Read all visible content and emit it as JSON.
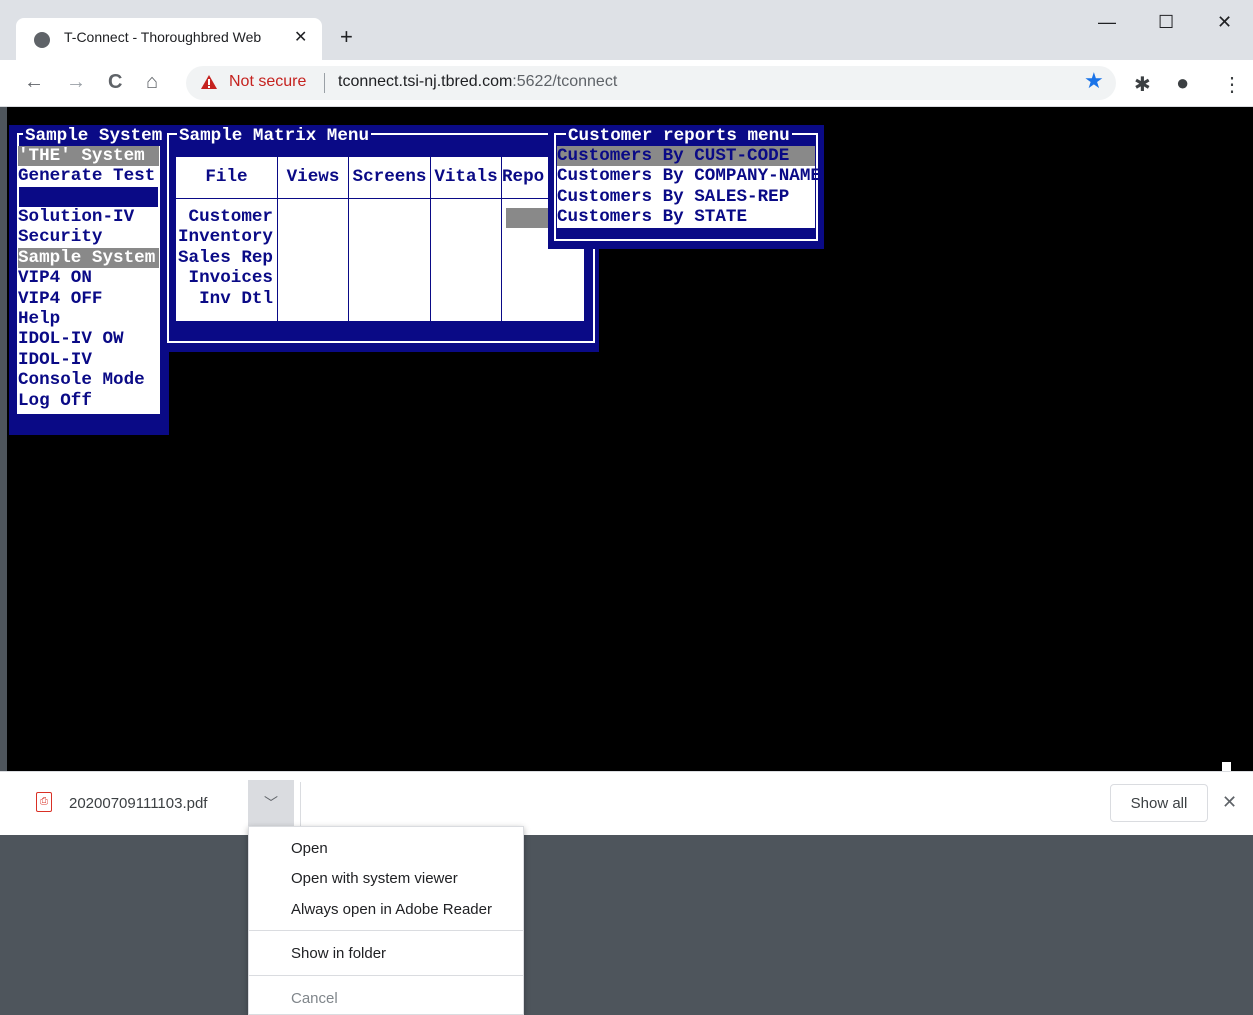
{
  "browser": {
    "tab_title": "T-Connect - Thoroughbred Web",
    "tab_close": "✕",
    "new_tab": "+",
    "win_minimize": "—",
    "win_maximize": "☐",
    "win_close": "✕",
    "back": "←",
    "forward": "→",
    "reload": "C",
    "home": "⌂",
    "not_secure": "Not secure",
    "url_host": "tconnect.tsi-nj.tbred.com",
    "url_rest": ":5622/tconnect",
    "star": "★",
    "extensions": "✱",
    "profile": "●",
    "menu": "⋮"
  },
  "terminal": {
    "system_menu": {
      "title": "Sample System",
      "items_top": [
        "'THE' System",
        "Generate Test"
      ],
      "items": [
        "Solution-IV",
        "Security",
        "Sample System",
        "VIP4 ON",
        "VIP4 OFF",
        "Help",
        "IDOL-IV OW",
        "IDOL-IV",
        "Console Mode",
        "Log Off"
      ]
    },
    "matrix_menu": {
      "title": "Sample Matrix Menu",
      "columns": [
        "File",
        "Views",
        "Screens",
        "Vitals",
        "Repo"
      ],
      "file_items": [
        "Customer",
        "Inventory",
        "Sales Rep",
        "Invoices",
        "Inv Dtl"
      ]
    },
    "customer_menu": {
      "title": "Customer reports menu",
      "items": [
        "Customers By CUST-CODE",
        "Customers By COMPANY-NAME",
        "Customers By SALES-REP",
        "Customers By STATE"
      ]
    }
  },
  "downloads": {
    "file_name": "20200709111103.pdf",
    "pdf_icon": "⎙",
    "chevron": "﹀",
    "show_all": "Show all",
    "close": "✕",
    "menu": {
      "open": "Open",
      "open_system": "Open with system viewer",
      "always_adobe": "Always open in Adobe Reader",
      "show_folder": "Show in folder",
      "cancel": "Cancel"
    }
  }
}
